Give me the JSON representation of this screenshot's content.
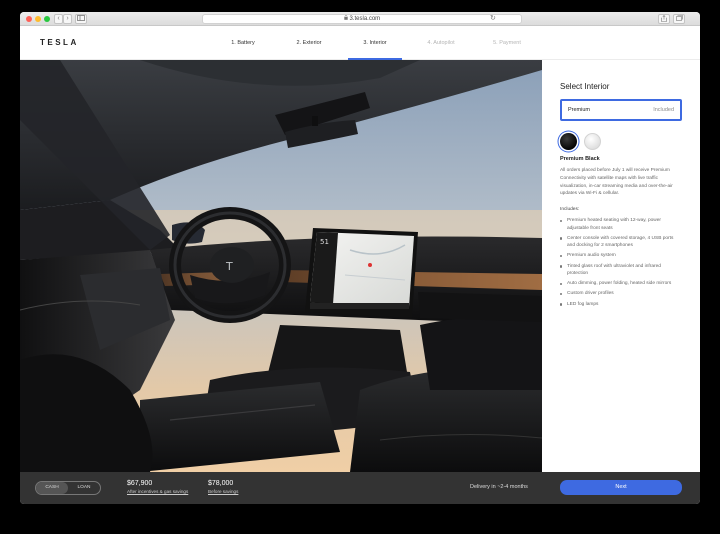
{
  "browser": {
    "url": "3.tesla.com",
    "back_glyph": "‹",
    "forward_glyph": "›"
  },
  "header": {
    "logo_text": "TESLA",
    "steps": [
      {
        "label": "1. Battery",
        "state": "done"
      },
      {
        "label": "2. Exterior",
        "state": "done"
      },
      {
        "label": "3. Interior",
        "state": "active"
      },
      {
        "label": "4. Autopilot",
        "state": "disabled"
      },
      {
        "label": "5. Payment",
        "state": "disabled"
      }
    ]
  },
  "panel": {
    "title": "Select Interior",
    "option": {
      "name": "Premium",
      "note": "Included"
    },
    "swatches": [
      {
        "name": "Premium Black",
        "color": "#111111",
        "selected": true
      },
      {
        "name": "Premium White",
        "color": "#f2f2f2",
        "selected": false
      }
    ],
    "selected_name": "Premium Black",
    "description": "All orders placed before July 1 will receive Premium Connectivity with satellite maps with live traffic visualization, in-car streaming media and over-the-air updates via Wi-Fi & cellular.",
    "includes_label": "Includes:",
    "features": [
      "Premium heated seating with 12-way, power adjustable front seats",
      "Center console with covered storage, 4 USB ports and docking for 2 smartphones",
      "Premium audio system",
      "Tinted glass roof with ultraviolet and infrared protection",
      "Auto dimming, power folding, heated side mirrors",
      "Custom driver profiles",
      "LED fog lamps"
    ]
  },
  "footer": {
    "payment_options": [
      "CASH",
      "LOAN"
    ],
    "active_payment": "CASH",
    "price_after": "$67,900",
    "price_after_label": "After incentives & gas savings",
    "price_before": "$78,000",
    "price_before_label": "Before savings",
    "delivery": "Delivery in ~2-4 months",
    "next_label": "Next"
  },
  "colors": {
    "accent": "#3e6ae1",
    "footer_bg": "#333333"
  }
}
